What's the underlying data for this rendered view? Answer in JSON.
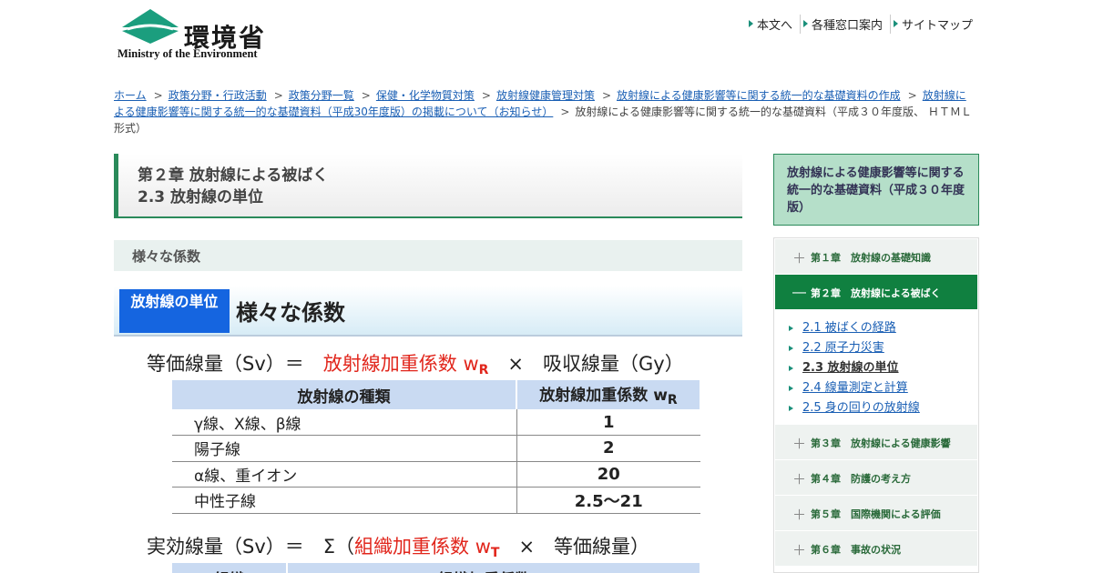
{
  "header": {
    "logo_jp": "環境省",
    "logo_en": "Ministry of the Environment",
    "links": [
      "本文へ",
      "各種窓口案内",
      "サイトマップ"
    ]
  },
  "breadcrumb": {
    "links": [
      "ホーム",
      "政策分野・行政活動",
      "政策分野一覧",
      "保健・化学物質対策",
      "放射線健康管理対策",
      "放射線による健康影響等に関する統一的な基礎資料の作成",
      "放射線による健康影響等に関する統一的な基礎資料（平成30年度版）の掲載について（お知らせ）"
    ],
    "current": "放射線による健康影響等に関する統一的な基礎資料（平成３０年度版、 ＨＴＭＬ形式）"
  },
  "main": {
    "title_line1": "第２章 放射線による被ばく",
    "title_line2": "2.3 放射線の単位",
    "section_heading": "様々な係数"
  },
  "figure": {
    "badge": "放射線の単位",
    "title": "様々な係数",
    "formula1": {
      "left": "等価線量（Sv）＝",
      "red": "放射線加重係数 w",
      "red_sub": "R",
      "right": "×　吸収線量（Gy）"
    },
    "table1": {
      "headers": [
        "放射線の種類",
        "放射線加重係数 w"
      ],
      "header_sub": "R",
      "rows": [
        [
          "γ線、X線、β線",
          "1"
        ],
        [
          "陽子線",
          "2"
        ],
        [
          "α線、重イオン",
          "20"
        ],
        [
          "中性子線",
          "2.5〜21"
        ]
      ]
    },
    "formula2": {
      "left": "実効線量（Sv）＝　Σ（",
      "red": "組織加重係数 w",
      "red_sub": "T",
      "right": "×　等価線量）"
    },
    "table2_headers": [
      "組織",
      "組織加重係数 w"
    ]
  },
  "sidebar": {
    "heading": "放射線による健康影響等に関する統一的な基礎資料（平成３０年度版）",
    "chapters": [
      {
        "label": "第１章　放射線の基礎知識"
      },
      {
        "label": "第２章　放射線による被ばく"
      },
      {
        "label": "第３章　放射線による健康影響"
      },
      {
        "label": "第４章　防護の考え方"
      },
      {
        "label": "第５章　国際機関による評価"
      },
      {
        "label": "第６章　事故の状況"
      }
    ],
    "sub_items": [
      "2.1 被ばくの経路",
      "2.2 原子力災害",
      "2.3 放射線の単位",
      "2.4 線量測定と計算",
      "2.5 身の回りの放射線"
    ],
    "plus_mark": "＋",
    "minus_mark": "―"
  },
  "colors": {
    "accent": "#108040",
    "link": "#1a5fb4",
    "highlight_red": "#e1261c",
    "badge_blue": "#1565e0"
  }
}
